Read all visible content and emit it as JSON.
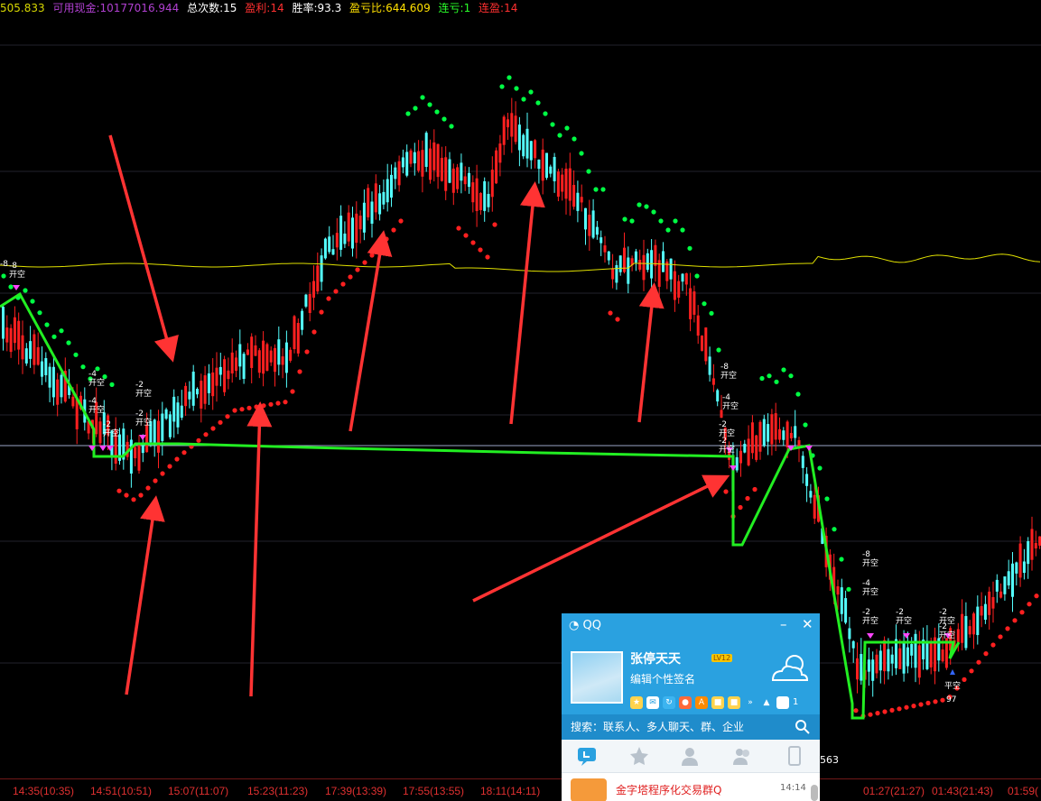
{
  "header": {
    "equity": "505.833",
    "cash": "可用现金:10177016.944",
    "trades": "总次数:15",
    "wins": "盈利:14",
    "winrate": "胜率:93.3",
    "profit_ratio": "盈亏比:644.609",
    "loss_streak": "连亏:1",
    "win_streak": "连盈:14"
  },
  "colors": {
    "up": "#ff2020",
    "down": "#54ffff",
    "sar": "#00ff44",
    "equity_line": "#22ee22",
    "ref_line": "#e0e000",
    "arrow": "#ff3333",
    "axis": "#e03030",
    "label_open": "#ffffff",
    "marker_down": "#ff44ff",
    "marker_up": "#3366ff"
  },
  "chart_data": {
    "type": "candlestick",
    "price_labels": [
      "-8",
      "563",
      "97"
    ],
    "x_ticks": [
      "14:35(10:35)",
      "14:51(10:51)",
      "15:07(11:07)",
      "15:23(11:23)",
      "17:39(13:39)",
      "17:55(13:55)",
      "18:11(14:11)",
      "01:27(21:27)",
      "01:43(21:43)",
      "01:59("
    ],
    "signals": [
      {
        "size": "-8",
        "type": "开空"
      },
      {
        "size": "-4",
        "type": "开空"
      },
      {
        "size": "-2",
        "type": "开空"
      },
      {
        "size": "-2",
        "type": "开空"
      },
      {
        "size": "-4",
        "type": "开空"
      },
      {
        "size": "-2",
        "type": "开空"
      },
      {
        "size": "-8",
        "type": "开空"
      },
      {
        "size": "-4",
        "type": "开空"
      },
      {
        "size": "-2",
        "type": "开空"
      },
      {
        "size": "-2",
        "type": "开空"
      },
      {
        "size": "-8",
        "type": "开空"
      },
      {
        "size": "-4",
        "type": "开空"
      },
      {
        "size": "-2",
        "type": "开空"
      },
      {
        "size": "-2",
        "type": "开空"
      },
      {
        "size": "-2",
        "type": "开空"
      },
      {
        "size": "-2",
        "type": "开空"
      },
      {
        "size": "",
        "type": "平空"
      }
    ]
  },
  "qq": {
    "title": "QQ",
    "name": "张停天天",
    "level": "LV12",
    "signature": "编辑个性签名",
    "badge": "1",
    "search_placeholder": "搜索：联系人、多人聊天、群、企业",
    "item_name": "金字塔程序化交易群Q",
    "item_time": "14:14"
  }
}
